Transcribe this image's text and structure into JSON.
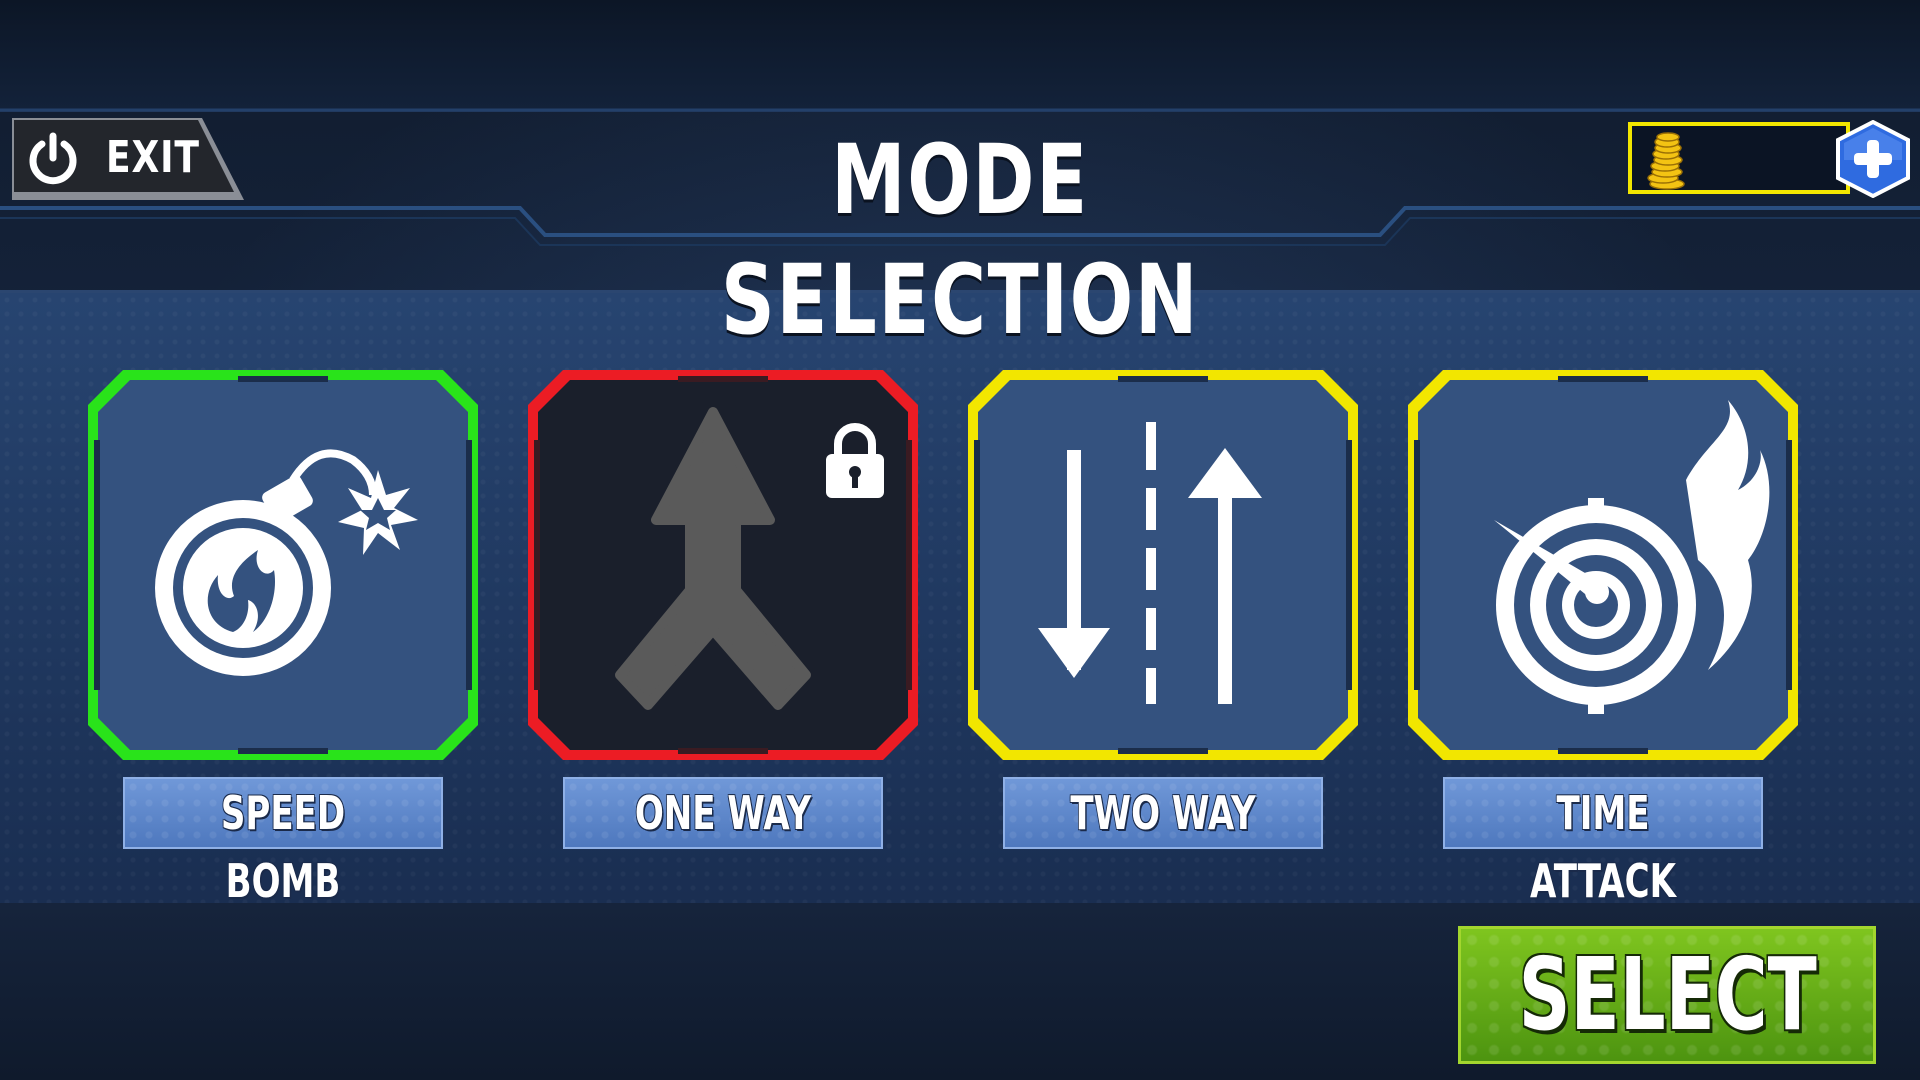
{
  "header": {
    "exit_label": "EXIT",
    "title": "MODE SELECTION",
    "coins_value": ""
  },
  "modes": [
    {
      "label": "SPEED BOMB",
      "icon": "bomb-icon",
      "state": "selected",
      "frame_color": "#29e31a"
    },
    {
      "label": "ONE WAY",
      "icon": "merge-arrow-icon",
      "state": "locked",
      "frame_color": "#ec1c24"
    },
    {
      "label": "TWO WAY",
      "icon": "two-way-road-icon",
      "state": "unlocked",
      "frame_color": "#f2e600"
    },
    {
      "label": "TIME ATTACK",
      "icon": "flaming-speedometer-icon",
      "state": "unlocked",
      "frame_color": "#f2e600"
    }
  ],
  "select_label": "SELECT",
  "colors": {
    "accent_green": "#29e31a",
    "locked_red": "#ec1c24",
    "available_yellow": "#f2e600",
    "card_blue": "#34527f",
    "card_locked_dark": "#1a1f2b",
    "select_green": "#5fa517"
  },
  "icons": [
    "power-icon",
    "coin-stack-icon",
    "plus-icon",
    "lock-icon"
  ]
}
